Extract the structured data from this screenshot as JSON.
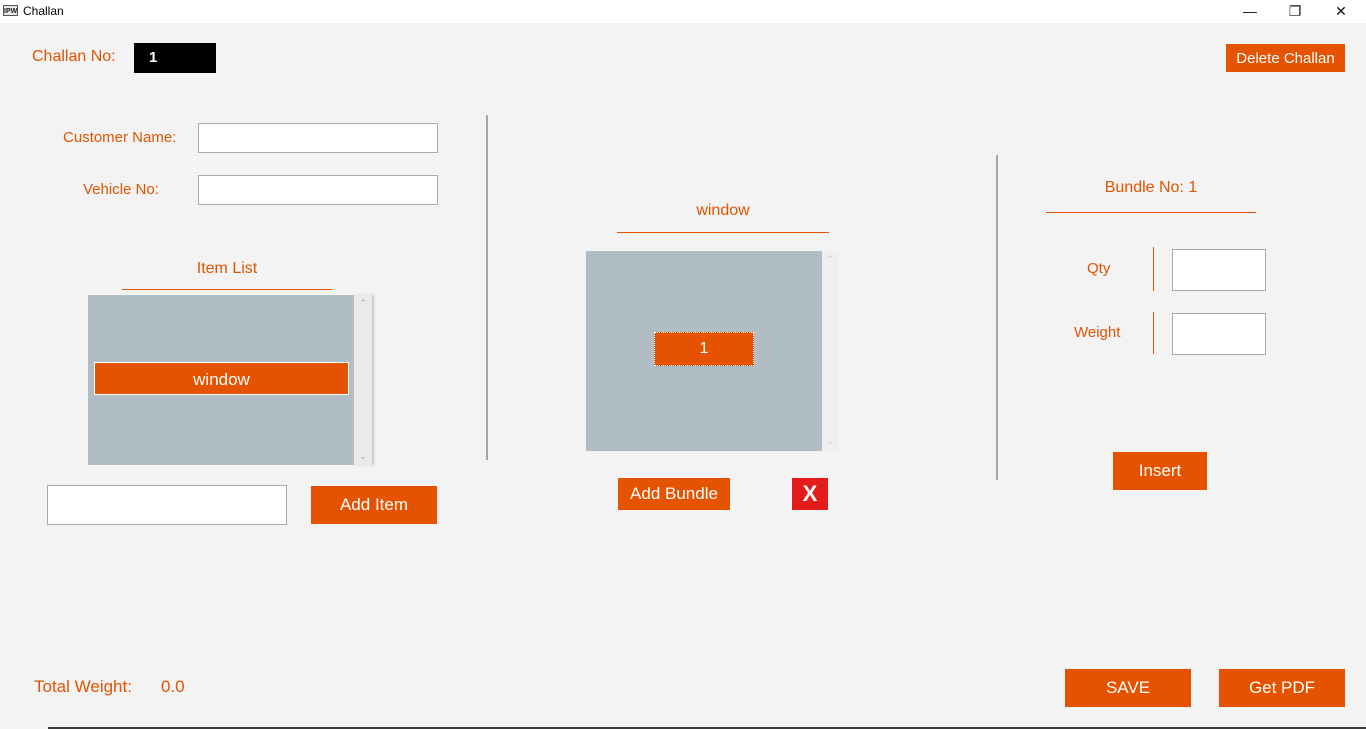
{
  "window": {
    "title": "Challan",
    "icon_label": "IPW",
    "minimize_glyph": "—",
    "restore_glyph": "❐",
    "close_glyph": "✕"
  },
  "header": {
    "challan_no_label": "Challan No:",
    "challan_no_value": "1",
    "delete_button": "Delete Challan"
  },
  "customer": {
    "name_label": "Customer Name:",
    "name_value": "",
    "vehicle_label": "Vehicle No:",
    "vehicle_value": ""
  },
  "item_list": {
    "heading": "Item List",
    "items": [
      "window"
    ],
    "selected": "window",
    "new_item_value": "",
    "add_button": "Add Item"
  },
  "bundles": {
    "heading": "window",
    "items": [
      "1"
    ],
    "selected": "1",
    "add_button": "Add Bundle",
    "remove_button": "X"
  },
  "bundle_detail": {
    "heading": "Bundle No: 1",
    "qty_label": "Qty",
    "qty_value": "",
    "weight_label": "Weight",
    "weight_value": "",
    "insert_button": "Insert"
  },
  "footer": {
    "total_weight_label": "Total Weight:",
    "total_weight_value": "0.0",
    "save_button": "SAVE",
    "pdf_button": "Get PDF"
  },
  "colors": {
    "accent": "#e55300",
    "listbox_bg": "#b1bdc4",
    "remove_red": "#e31b1b",
    "challan_bg": "#000000"
  },
  "icons": {
    "scroll_up": "scroll-up-arrow-icon",
    "scroll_down": "scroll-down-arrow-icon"
  }
}
